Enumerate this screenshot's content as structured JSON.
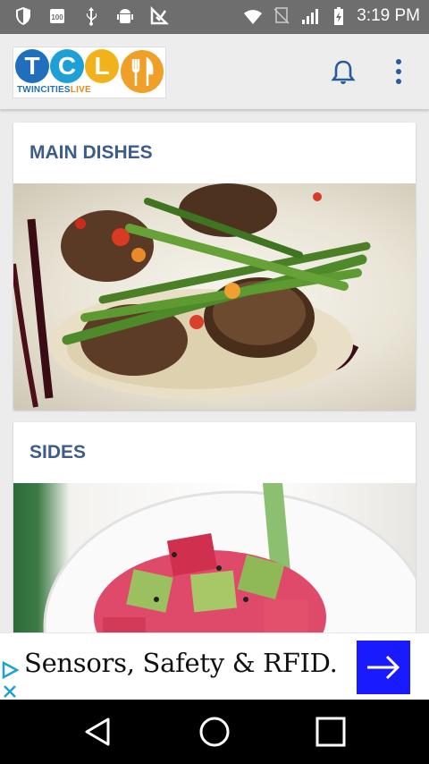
{
  "status_bar": {
    "time": "3:19 PM",
    "left_icons": [
      "shield-icon",
      "battery-100-icon",
      "usb-icon",
      "android-icon",
      "sign-icon"
    ],
    "right_icons": [
      "wifi-icon",
      "no-sim-icon",
      "signal-icon",
      "battery-icon"
    ]
  },
  "app_bar": {
    "logo": {
      "letters": [
        "T",
        "C",
        "L"
      ],
      "subtitle_a": "TWINCITIES",
      "subtitle_b": "LIVE"
    },
    "bell_icon": "bell-icon",
    "menu_icon": "more-vert-icon"
  },
  "cards": [
    {
      "title": "MAIN DISHES",
      "image": "seared-scallops-with-asparagus"
    },
    {
      "title": "SIDES",
      "image": "tuna-poke-bowl"
    }
  ],
  "ad": {
    "text": "Sensors, Safety & RFID.",
    "cta_icon": "arrow-right-icon",
    "colors": {
      "cta": "#1a1aff",
      "adchoices": "#1ea0d8"
    }
  },
  "nav_bar": {
    "buttons": [
      "back-icon",
      "home-icon",
      "recents-icon"
    ]
  },
  "colors": {
    "title": "#3d5c8a",
    "status_bar": "#6e6e6e",
    "app_bar": "#ededed",
    "bell": "#2b5a9a"
  }
}
